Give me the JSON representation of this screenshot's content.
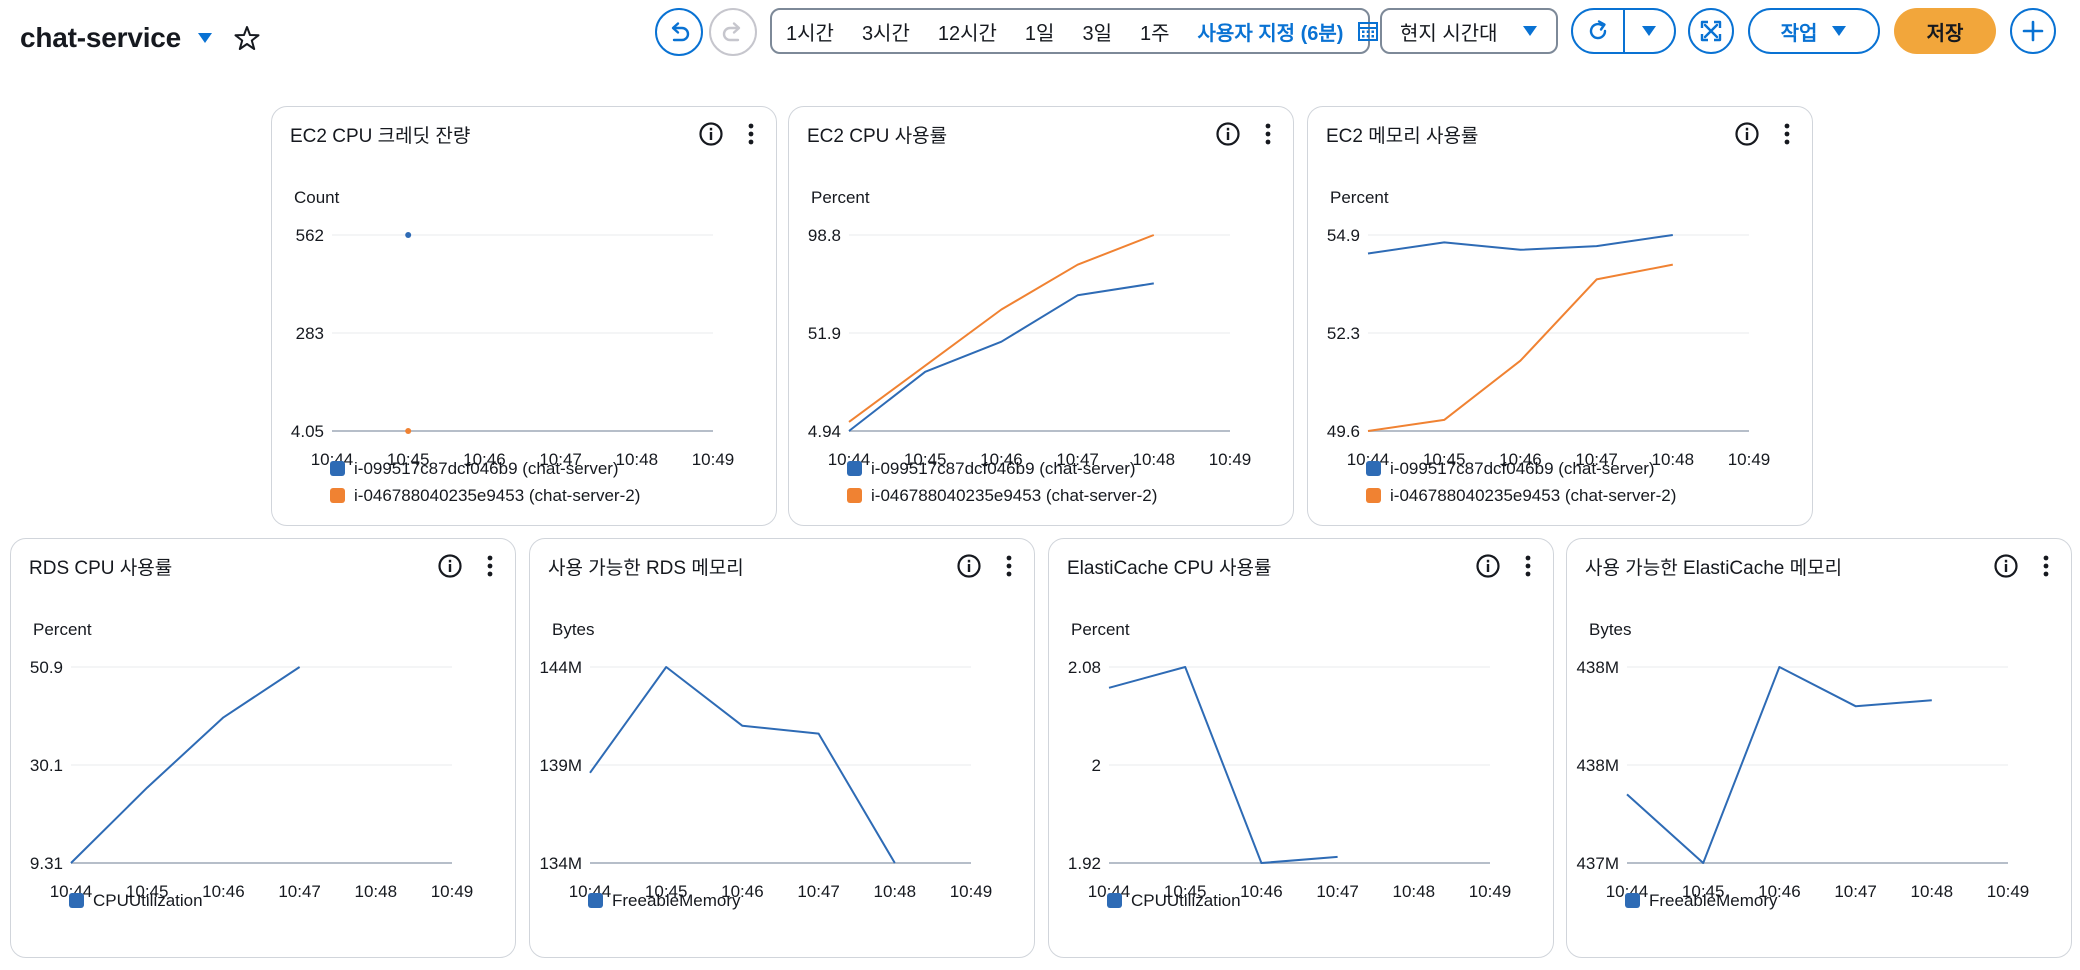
{
  "header": {
    "title": "chat-service",
    "time_ranges": [
      "1시간",
      "3시간",
      "12시간",
      "1일",
      "3일",
      "1주"
    ],
    "custom_range_label": "사용자 지정 (6분)",
    "timezone_label": "현지 시간대",
    "actions_label": "작업",
    "save_label": "저장"
  },
  "colors": {
    "blue": "#2e6bb5",
    "orange": "#f08232",
    "accent": "#0972d3",
    "save": "#f2a63b"
  },
  "icons": [
    "caret-down-icon",
    "star-icon",
    "undo-icon",
    "redo-icon",
    "calendar-icon",
    "refresh-icon",
    "fullscreen-icon",
    "plus-icon",
    "info-icon",
    "more-vertical-icon"
  ],
  "chart_data": [
    {
      "type": "scatter",
      "title": "EC2 CPU 크레딧 잔량",
      "ylabel": "Count",
      "xticks": [
        "10:44",
        "10:45",
        "10:46",
        "10:47",
        "10:48",
        "10:49"
      ],
      "yticks": [
        "562",
        "283",
        "4.05"
      ],
      "ylim": [
        4.05,
        562
      ],
      "series": [
        {
          "name": "i-099517c87dcf046b9 (chat-server)",
          "color": "#2e6bb5",
          "points": [
            [
              1,
              562
            ]
          ]
        },
        {
          "name": "i-046788040235e9453 (chat-server-2)",
          "color": "#f08232",
          "points": [
            [
              1,
              4.05
            ]
          ]
        }
      ]
    },
    {
      "type": "line",
      "title": "EC2 CPU 사용률",
      "ylabel": "Percent",
      "xticks": [
        "10:44",
        "10:45",
        "10:46",
        "10:47",
        "10:48",
        "10:49"
      ],
      "yticks": [
        "98.8",
        "51.9",
        "4.94"
      ],
      "ylim": [
        4.94,
        98.8
      ],
      "series": [
        {
          "name": "i-099517c87dcf046b9 (chat-server)",
          "color": "#2e6bb5",
          "points": [
            [
              0,
              4.94
            ],
            [
              1,
              33.3
            ],
            [
              2,
              47.7
            ],
            [
              3,
              69.9
            ],
            [
              4,
              75.6
            ]
          ]
        },
        {
          "name": "i-046788040235e9453 (chat-server-2)",
          "color": "#f08232",
          "points": [
            [
              0,
              9.3
            ],
            [
              1,
              36.2
            ],
            [
              2,
              63.1
            ],
            [
              3,
              84.6
            ],
            [
              4,
              98.8
            ]
          ]
        }
      ]
    },
    {
      "type": "line",
      "title": "EC2 메모리 사용률",
      "ylabel": "Percent",
      "xticks": [
        "10:44",
        "10:45",
        "10:46",
        "10:47",
        "10:48",
        "10:49"
      ],
      "yticks": [
        "54.9",
        "52.3",
        "49.6"
      ],
      "ylim": [
        49.6,
        54.9
      ],
      "series": [
        {
          "name": "i-099517c87dcf046b9 (chat-server)",
          "color": "#2e6bb5",
          "points": [
            [
              0,
              54.4
            ],
            [
              1,
              54.7
            ],
            [
              2,
              54.5
            ],
            [
              3,
              54.6
            ],
            [
              4,
              54.9
            ]
          ]
        },
        {
          "name": "i-046788040235e9453 (chat-server-2)",
          "color": "#f08232",
          "points": [
            [
              0,
              49.6
            ],
            [
              1,
              49.9
            ],
            [
              2,
              51.5
            ],
            [
              3,
              53.7
            ],
            [
              4,
              54.1
            ]
          ]
        }
      ]
    },
    {
      "type": "line",
      "title": "RDS CPU 사용률",
      "ylabel": "Percent",
      "xticks": [
        "10:44",
        "10:45",
        "10:46",
        "10:47",
        "10:48",
        "10:49"
      ],
      "yticks": [
        "50.9",
        "30.1",
        "9.31"
      ],
      "ylim": [
        9.31,
        50.9
      ],
      "series": [
        {
          "name": "CPUUtilization",
          "color": "#2e6bb5",
          "points": [
            [
              0,
              9.31
            ],
            [
              1,
              25.3
            ],
            [
              2,
              40.2
            ],
            [
              3,
              50.9
            ]
          ]
        }
      ]
    },
    {
      "type": "line",
      "title": "사용 가능한 RDS 메모리",
      "ylabel": "Bytes",
      "xticks": [
        "10:44",
        "10:45",
        "10:46",
        "10:47",
        "10:48",
        "10:49"
      ],
      "yticks": [
        "144M",
        "139M",
        "134M"
      ],
      "ylim": [
        134,
        144
      ],
      "series": [
        {
          "name": "FreeableMemory",
          "color": "#2e6bb5",
          "points": [
            [
              0,
              138.6
            ],
            [
              1,
              144
            ],
            [
              2,
              141.0
            ],
            [
              3,
              140.6
            ],
            [
              4,
              134
            ]
          ]
        }
      ]
    },
    {
      "type": "line",
      "title": "ElastiCache CPU 사용률",
      "ylabel": "Percent",
      "xticks": [
        "10:44",
        "10:45",
        "10:46",
        "10:47",
        "10:48",
        "10:49"
      ],
      "yticks": [
        "2.08",
        "2",
        "1.92"
      ],
      "ylim": [
        1.92,
        2.08
      ],
      "series": [
        {
          "name": "CPUUtilization",
          "color": "#2e6bb5",
          "points": [
            [
              0,
              2.063
            ],
            [
              1,
              2.08
            ],
            [
              2,
              1.92
            ],
            [
              3,
              1.925
            ]
          ]
        }
      ]
    },
    {
      "type": "line",
      "title": "사용 가능한 ElastiCache 메모리",
      "ylabel": "Bytes",
      "xticks": [
        "10:44",
        "10:45",
        "10:46",
        "10:47",
        "10:48",
        "10:49"
      ],
      "yticks": [
        "438M",
        "438M",
        "437M"
      ],
      "ylim": [
        0,
        1
      ],
      "series": [
        {
          "name": "FreeableMemory",
          "color": "#2e6bb5",
          "points": [
            [
              0,
              0.35
            ],
            [
              1,
              0
            ],
            [
              2,
              1
            ],
            [
              3,
              0.8
            ],
            [
              4,
              0.83
            ]
          ]
        }
      ]
    }
  ]
}
